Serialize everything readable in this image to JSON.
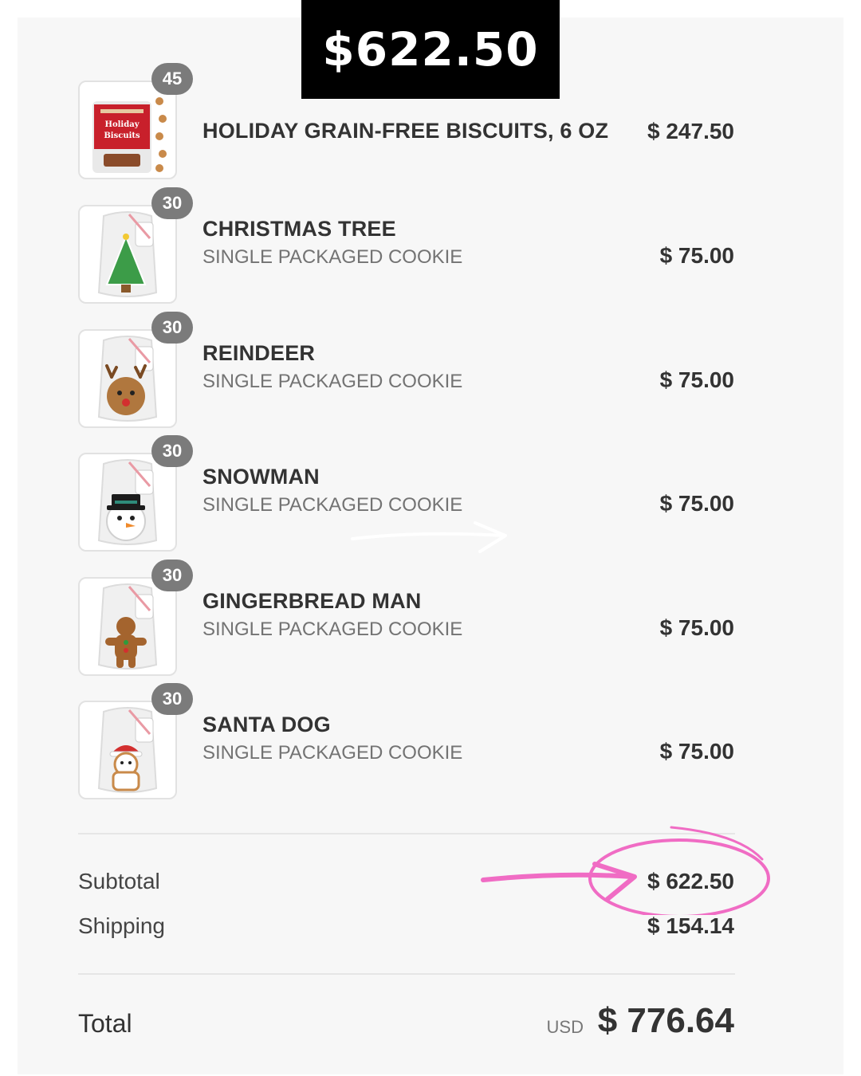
{
  "banner": {
    "amount": "$622.50"
  },
  "items": [
    {
      "name": "HOLIDAY GRAIN-FREE BISCUITS, 6 OZ",
      "variant": "",
      "quantity": "45",
      "price": "$ 247.50",
      "icon": "biscuit-bag-icon",
      "bag_text": "Holiday Biscuits"
    },
    {
      "name": "CHRISTMAS TREE",
      "variant": "SINGLE PACKAGED COOKIE",
      "quantity": "30",
      "price": "$ 75.00",
      "icon": "christmas-tree-cookie-icon"
    },
    {
      "name": "REINDEER",
      "variant": "SINGLE PACKAGED COOKIE",
      "quantity": "30",
      "price": "$ 75.00",
      "icon": "reindeer-cookie-icon"
    },
    {
      "name": "SNOWMAN",
      "variant": "SINGLE PACKAGED COOKIE",
      "quantity": "30",
      "price": "$ 75.00",
      "icon": "snowman-cookie-icon"
    },
    {
      "name": "GINGERBREAD MAN",
      "variant": "SINGLE PACKAGED COOKIE",
      "quantity": "30",
      "price": "$ 75.00",
      "icon": "gingerbread-cookie-icon"
    },
    {
      "name": "SANTA DOG",
      "variant": "SINGLE PACKAGED COOKIE",
      "quantity": "30",
      "price": "$ 75.00",
      "icon": "santa-dog-cookie-icon"
    }
  ],
  "summary": {
    "subtotal_label": "Subtotal",
    "subtotal_value": "$ 622.50",
    "shipping_label": "Shipping",
    "shipping_value": "$ 154.14"
  },
  "total": {
    "label": "Total",
    "currency": "USD",
    "value": "$ 776.64"
  },
  "colors": {
    "highlight": "#f06cc4",
    "badge": "#7b7b7b",
    "banner": "#000000"
  }
}
